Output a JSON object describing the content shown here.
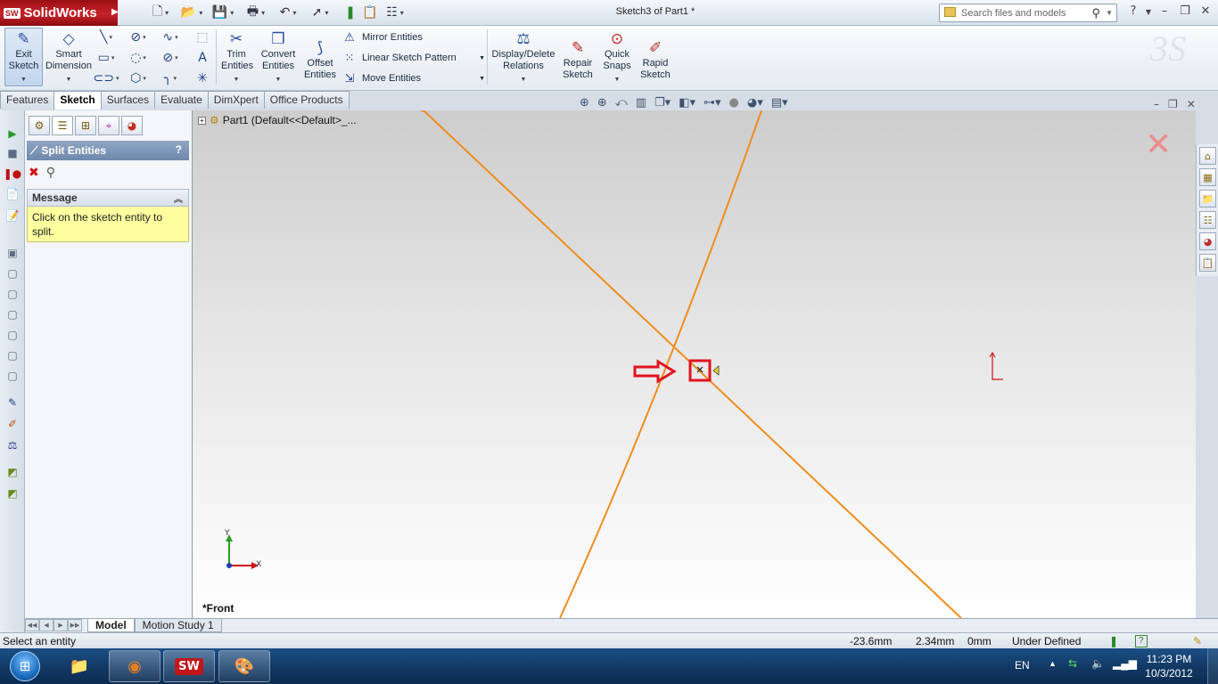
{
  "app": {
    "name": "SolidWorks",
    "logo_badge": "SW",
    "document_title": "Sketch3 of Part1 *",
    "search_placeholder": "Search files and models",
    "help_label": "?"
  },
  "ribbon": {
    "exit_sketch": "Exit Sketch",
    "smart_dimension": "Smart Dimension",
    "trim_entities": "Trim Entities",
    "convert_entities": "Convert Entities",
    "offset_entities": "Offset Entities",
    "mirror_entities": "Mirror Entities",
    "linear_sketch_pattern": "Linear Sketch Pattern",
    "move_entities": "Move Entities",
    "display_delete_relations": "Display/Delete Relations",
    "repair_sketch": "Repair Sketch",
    "quick_snaps": "Quick Snaps",
    "rapid_sketch": "Rapid Sketch"
  },
  "tabs": [
    "Features",
    "Sketch",
    "Surfaces",
    "Evaluate",
    "DimXpert",
    "Office Products"
  ],
  "active_tab": "Sketch",
  "property_manager": {
    "title": "Split Entities",
    "help": "?",
    "message_group_title": "Message",
    "message_text": "Click on the sketch entity to split."
  },
  "feature_tree": {
    "root": "Part1  (Default<<Default>_..."
  },
  "viewport": {
    "view_name": "*Front",
    "axis_y": "Y",
    "axis_x": "X",
    "sketch_color": "#f08c1e",
    "highlight_color": "#e0141e"
  },
  "bottom_tabs": [
    "Model",
    "Motion Study 1"
  ],
  "status": {
    "message": "Select an entity",
    "x": "-23.6mm",
    "y": "2.34mm",
    "z": "0mm",
    "state": "Under Defined",
    "help": "?"
  },
  "taskbar": {
    "language": "EN",
    "time": "11:23 PM",
    "date": "10/3/2012"
  }
}
